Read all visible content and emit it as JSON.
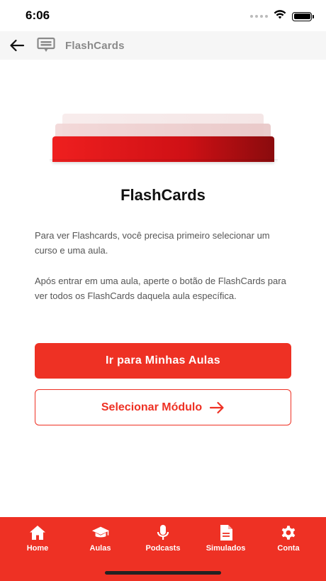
{
  "status": {
    "time": "6:06"
  },
  "header": {
    "title": "FlashCards"
  },
  "content": {
    "title": "FlashCards",
    "paragraph1": "Para ver Flashcards, você precisa primeiro selecionar um curso e uma aula.",
    "paragraph2": "Após entrar em uma aula, aperte o botão de FlashCards para ver todos os FlashCards daquela aula específica.",
    "primary_button": "Ir para Minhas Aulas",
    "secondary_button": "Selecionar Módulo"
  },
  "nav": {
    "items": [
      {
        "label": "Home",
        "icon": "home-icon"
      },
      {
        "label": "Aulas",
        "icon": "graduation-cap-icon"
      },
      {
        "label": "Podcasts",
        "icon": "microphone-icon"
      },
      {
        "label": "Simulados",
        "icon": "document-icon"
      },
      {
        "label": "Conta",
        "icon": "gear-icon"
      }
    ]
  },
  "colors": {
    "accent": "#ee3124",
    "header_bg": "#f6f6f6",
    "header_text": "#8a8a8a"
  }
}
